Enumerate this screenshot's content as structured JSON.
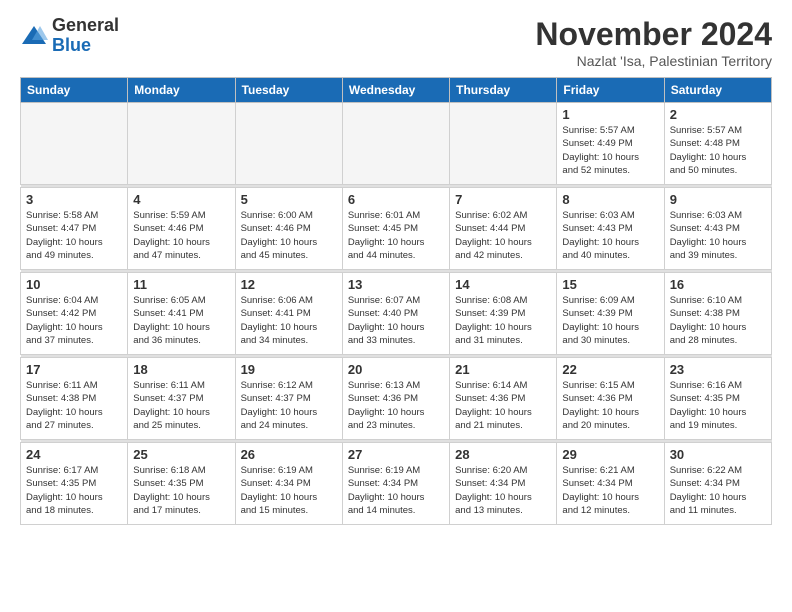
{
  "logo": {
    "general": "General",
    "blue": "Blue"
  },
  "header": {
    "month": "November 2024",
    "location": "Nazlat 'Isa, Palestinian Territory"
  },
  "weekdays": [
    "Sunday",
    "Monday",
    "Tuesday",
    "Wednesday",
    "Thursday",
    "Friday",
    "Saturday"
  ],
  "weeks": [
    [
      {
        "day": "",
        "info": ""
      },
      {
        "day": "",
        "info": ""
      },
      {
        "day": "",
        "info": ""
      },
      {
        "day": "",
        "info": ""
      },
      {
        "day": "",
        "info": ""
      },
      {
        "day": "1",
        "info": "Sunrise: 5:57 AM\nSunset: 4:49 PM\nDaylight: 10 hours\nand 52 minutes."
      },
      {
        "day": "2",
        "info": "Sunrise: 5:57 AM\nSunset: 4:48 PM\nDaylight: 10 hours\nand 50 minutes."
      }
    ],
    [
      {
        "day": "3",
        "info": "Sunrise: 5:58 AM\nSunset: 4:47 PM\nDaylight: 10 hours\nand 49 minutes."
      },
      {
        "day": "4",
        "info": "Sunrise: 5:59 AM\nSunset: 4:46 PM\nDaylight: 10 hours\nand 47 minutes."
      },
      {
        "day": "5",
        "info": "Sunrise: 6:00 AM\nSunset: 4:46 PM\nDaylight: 10 hours\nand 45 minutes."
      },
      {
        "day": "6",
        "info": "Sunrise: 6:01 AM\nSunset: 4:45 PM\nDaylight: 10 hours\nand 44 minutes."
      },
      {
        "day": "7",
        "info": "Sunrise: 6:02 AM\nSunset: 4:44 PM\nDaylight: 10 hours\nand 42 minutes."
      },
      {
        "day": "8",
        "info": "Sunrise: 6:03 AM\nSunset: 4:43 PM\nDaylight: 10 hours\nand 40 minutes."
      },
      {
        "day": "9",
        "info": "Sunrise: 6:03 AM\nSunset: 4:43 PM\nDaylight: 10 hours\nand 39 minutes."
      }
    ],
    [
      {
        "day": "10",
        "info": "Sunrise: 6:04 AM\nSunset: 4:42 PM\nDaylight: 10 hours\nand 37 minutes."
      },
      {
        "day": "11",
        "info": "Sunrise: 6:05 AM\nSunset: 4:41 PM\nDaylight: 10 hours\nand 36 minutes."
      },
      {
        "day": "12",
        "info": "Sunrise: 6:06 AM\nSunset: 4:41 PM\nDaylight: 10 hours\nand 34 minutes."
      },
      {
        "day": "13",
        "info": "Sunrise: 6:07 AM\nSunset: 4:40 PM\nDaylight: 10 hours\nand 33 minutes."
      },
      {
        "day": "14",
        "info": "Sunrise: 6:08 AM\nSunset: 4:39 PM\nDaylight: 10 hours\nand 31 minutes."
      },
      {
        "day": "15",
        "info": "Sunrise: 6:09 AM\nSunset: 4:39 PM\nDaylight: 10 hours\nand 30 minutes."
      },
      {
        "day": "16",
        "info": "Sunrise: 6:10 AM\nSunset: 4:38 PM\nDaylight: 10 hours\nand 28 minutes."
      }
    ],
    [
      {
        "day": "17",
        "info": "Sunrise: 6:11 AM\nSunset: 4:38 PM\nDaylight: 10 hours\nand 27 minutes."
      },
      {
        "day": "18",
        "info": "Sunrise: 6:11 AM\nSunset: 4:37 PM\nDaylight: 10 hours\nand 25 minutes."
      },
      {
        "day": "19",
        "info": "Sunrise: 6:12 AM\nSunset: 4:37 PM\nDaylight: 10 hours\nand 24 minutes."
      },
      {
        "day": "20",
        "info": "Sunrise: 6:13 AM\nSunset: 4:36 PM\nDaylight: 10 hours\nand 23 minutes."
      },
      {
        "day": "21",
        "info": "Sunrise: 6:14 AM\nSunset: 4:36 PM\nDaylight: 10 hours\nand 21 minutes."
      },
      {
        "day": "22",
        "info": "Sunrise: 6:15 AM\nSunset: 4:36 PM\nDaylight: 10 hours\nand 20 minutes."
      },
      {
        "day": "23",
        "info": "Sunrise: 6:16 AM\nSunset: 4:35 PM\nDaylight: 10 hours\nand 19 minutes."
      }
    ],
    [
      {
        "day": "24",
        "info": "Sunrise: 6:17 AM\nSunset: 4:35 PM\nDaylight: 10 hours\nand 18 minutes."
      },
      {
        "day": "25",
        "info": "Sunrise: 6:18 AM\nSunset: 4:35 PM\nDaylight: 10 hours\nand 17 minutes."
      },
      {
        "day": "26",
        "info": "Sunrise: 6:19 AM\nSunset: 4:34 PM\nDaylight: 10 hours\nand 15 minutes."
      },
      {
        "day": "27",
        "info": "Sunrise: 6:19 AM\nSunset: 4:34 PM\nDaylight: 10 hours\nand 14 minutes."
      },
      {
        "day": "28",
        "info": "Sunrise: 6:20 AM\nSunset: 4:34 PM\nDaylight: 10 hours\nand 13 minutes."
      },
      {
        "day": "29",
        "info": "Sunrise: 6:21 AM\nSunset: 4:34 PM\nDaylight: 10 hours\nand 12 minutes."
      },
      {
        "day": "30",
        "info": "Sunrise: 6:22 AM\nSunset: 4:34 PM\nDaylight: 10 hours\nand 11 minutes."
      }
    ]
  ]
}
